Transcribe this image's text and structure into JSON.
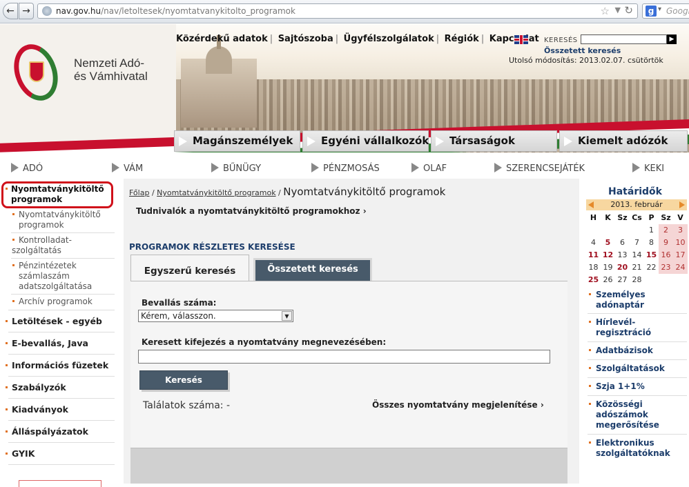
{
  "browser": {
    "url_prefix": "nav.gov.hu",
    "url_path": "/nav/letoltesek/nyomtatvanykitolto_programok",
    "search_placeholder": "Googl"
  },
  "header": {
    "logo_line1": "Nemzeti Adó-",
    "logo_line2": "és Vámhivatal",
    "top_links": [
      "Közérdekű adatok",
      "Sajtószoba",
      "Ügyfélszolgálatok",
      "Régiók",
      "Kapcsolat"
    ],
    "search_label": "KERESÉS",
    "advanced_search": "Összetett keresés",
    "modified_label": "Utolsó módosítás: 2013.02.07.  csütörtök"
  },
  "main_tabs": [
    "Magánszemélyek",
    "Egyéni vállalkozók",
    "Társaságok",
    "Kiemelt adózók"
  ],
  "sec_nav": [
    "ADÓ",
    "VÁM",
    "BŰNÜGY",
    "PÉNZMOSÁS",
    "OLAF",
    "SZERENCSEJÁTÉK",
    "KEKI"
  ],
  "sidebar": {
    "active_line1": "Nyomtatványkitöltő",
    "active_line2": "programok",
    "subitems": [
      {
        "l1": "Nyomtatványkitöltő",
        "l2": "programok",
        "l3": ""
      },
      {
        "l1": "Kontrolladat-",
        "l2": "szolgáltatás",
        "l3": ""
      },
      {
        "l1": "Pénzintézetek",
        "l2": "számlaszám",
        "l3": "adatszolgáltatása"
      },
      {
        "l1": "Archív programok",
        "l2": "",
        "l3": ""
      }
    ],
    "items": [
      "Letöltések - egyéb",
      "E-bevallás, Java",
      "Információs füzetek",
      "Szabályzók",
      "Kiadványok",
      "Álláspályázatok",
      "GYIK"
    ]
  },
  "content": {
    "breadcrumb_home": "Főlap",
    "breadcrumb_parent": "Nyomtatványkitöltő programok",
    "breadcrumb_current": "Nyomtatványkitöltő programok",
    "info_link": "Tudnivalók a nyomtatványkitöltő programokhoz",
    "section_title": "PROGRAMOK RÉSZLETES KERESÉSE",
    "tab_simple": "Egyszerű keresés",
    "tab_advanced": "Összetett keresés",
    "label_form_number": "Bevallás száma:",
    "select_value": "Kérem, válasszon.",
    "label_keyword": "Keresett kifejezés a nyomtatvány megnevezésében:",
    "search_button": "Keresés",
    "results_label": "Találatok száma: -",
    "show_all": "Összes nyomtatvány megjelenítése"
  },
  "calendar": {
    "title": "Határidők",
    "month": "2013. február",
    "day_headers": [
      "H",
      "K",
      "Sz",
      "Cs",
      "P",
      "Sz",
      "V"
    ],
    "weeks": [
      [
        "",
        "",
        "",
        "",
        "1",
        "2",
        "3"
      ],
      [
        "4",
        "5",
        "6",
        "7",
        "8",
        "9",
        "10"
      ],
      [
        "11",
        "12",
        "13",
        "14",
        "15",
        "16",
        "17"
      ],
      [
        "18",
        "19",
        "20",
        "21",
        "22",
        "23",
        "24"
      ],
      [
        "25",
        "26",
        "27",
        "28",
        "",
        "",
        ""
      ]
    ],
    "deadline_days": [
      "5",
      "11",
      "12",
      "15",
      "20",
      "25"
    ]
  },
  "right_links": [
    {
      "l1": "Személyes",
      "l2": "adónaptár",
      "l3": ""
    },
    {
      "l1": "Hírlevél-",
      "l2": "regisztráció",
      "l3": ""
    },
    {
      "l1": "Adatbázisok",
      "l2": "",
      "l3": ""
    },
    {
      "l1": "Szolgáltatások",
      "l2": "",
      "l3": ""
    },
    {
      "l1": "Szja 1+1%",
      "l2": "",
      "l3": ""
    },
    {
      "l1": "Közösségi",
      "l2": "adószámok",
      "l3": "megerősítése"
    },
    {
      "l1": "Elektronikus",
      "l2": "szolgáltatóknak",
      "l3": ""
    }
  ],
  "colors": {
    "brand_blue": "#1c3d6b",
    "accent_red": "#c8102e",
    "accent_green": "#2f7d32",
    "button": "#485a6a"
  }
}
